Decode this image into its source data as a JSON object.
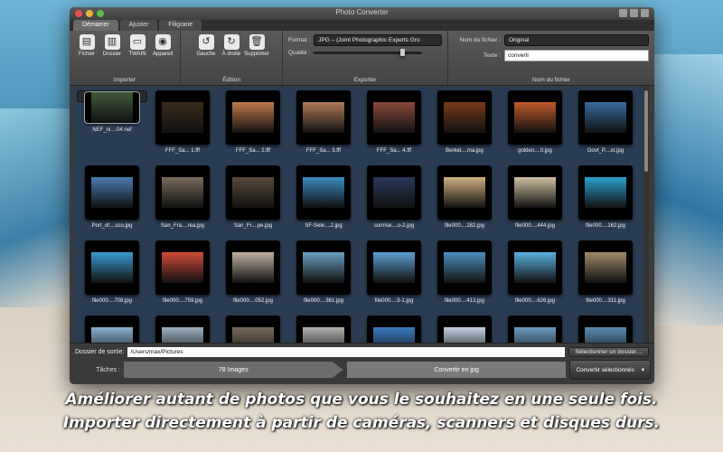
{
  "window": {
    "title": "Photo Converter"
  },
  "tabs": [
    {
      "label": "Démarrer"
    },
    {
      "label": "Ajuster"
    },
    {
      "label": "Filigrane"
    }
  ],
  "toolbar": {
    "import": {
      "group_label": "Importer",
      "buttons": [
        {
          "label": "Fichier",
          "icon": "file-icon"
        },
        {
          "label": "Dossier",
          "icon": "folder-icon"
        },
        {
          "label": "TWAIN",
          "icon": "scanner-icon"
        },
        {
          "label": "Appareil",
          "icon": "camera-icon"
        }
      ]
    },
    "edit": {
      "group_label": "Édition",
      "buttons": [
        {
          "label": "Gauche",
          "icon": "rotate-left-icon"
        },
        {
          "label": "À droite",
          "icon": "rotate-right-icon"
        },
        {
          "label": "Supprimer",
          "icon": "trash-icon"
        }
      ]
    },
    "export": {
      "group_label": "Exporter",
      "format_label": "Format :",
      "format_value": "JPG – (Joint Photographic Experts Gro",
      "quality_label": "Qualité :",
      "quality_fraction": 0.8
    },
    "filename": {
      "group_label": "Nom du fichier",
      "name_label": "Nom du fichier :",
      "name_value": "Original",
      "text_label": "Texte :",
      "text_value": "converti"
    }
  },
  "photos": [
    {
      "caption": "NEF_ni....04.nef",
      "color": "#3f5a3a",
      "selected": true
    },
    {
      "caption": "FFF_Sa... 1.fff",
      "color": "#3a2a1a"
    },
    {
      "caption": "FFF_Sa... 2.fff",
      "color": "#c07a4a"
    },
    {
      "caption": "FFF_Sa... 3.fff",
      "color": "#b07a5a"
    },
    {
      "caption": "FFF_Sa... 4.fff",
      "color": "#8a4a3a"
    },
    {
      "caption": "Berkel....ma.jpg",
      "color": "#7a3a1a"
    },
    {
      "caption": "golden....0.jpg",
      "color": "#c05a2a"
    },
    {
      "caption": "Govt_P....xt.jpg",
      "color": "#3a6aa0"
    },
    {
      "caption": "Port_of....sco.jpg",
      "color": "#4a7ab0"
    },
    {
      "caption": "San_Fra....rea.jpg",
      "color": "#7a6a5a"
    },
    {
      "caption": "San_Fr....pe.jpg",
      "color": "#5a4a3a"
    },
    {
      "caption": "SF-Sele....2.jpg",
      "color": "#3a8ac0"
    },
    {
      "caption": "sunrise....o-2.jpg",
      "color": "#2a3a5a"
    },
    {
      "caption": "file000....282.jpg",
      "color": "#d0b080"
    },
    {
      "caption": "file000....444.jpg",
      "color": "#d0c0a0"
    },
    {
      "caption": "file000....162.jpg",
      "color": "#2aa0d0"
    },
    {
      "caption": "file000....708.jpg",
      "color": "#3a9ad0"
    },
    {
      "caption": "file000....759.jpg",
      "color": "#d04a3a"
    },
    {
      "caption": "file000....052.jpg",
      "color": "#c0b0a0"
    },
    {
      "caption": "file000....361.jpg",
      "color": "#6aa0c0"
    },
    {
      "caption": "file000....3-1.jpg",
      "color": "#5aa0d0"
    },
    {
      "caption": "file000....413.jpg",
      "color": "#4a90c0"
    },
    {
      "caption": "file000....626.jpg",
      "color": "#5ab0e0"
    },
    {
      "caption": "file000....311.jpg",
      "color": "#a08a6a"
    },
    {
      "caption": "",
      "color": "#8ab0d0"
    },
    {
      "caption": "",
      "color": "#9ab0c0"
    },
    {
      "caption": "",
      "color": "#7a6a5a"
    },
    {
      "caption": "",
      "color": "#b0b0b0"
    },
    {
      "caption": "",
      "color": "#3a7ac0"
    },
    {
      "caption": "",
      "color": "#c0d0e0"
    },
    {
      "caption": "",
      "color": "#6a9ac0"
    },
    {
      "caption": "",
      "color": "#5a8ab0"
    }
  ],
  "bottom": {
    "output_label": "Dossier de sortie:",
    "output_path": "/Users/max/Pictures",
    "choose_folder": "Sélectionner un dossier....",
    "tasks_label": "Tâches :",
    "stage_images": "78 Images",
    "stage_convert": "Convertir en jpg",
    "convert_button": "Convertir sélectionnés"
  },
  "caption": {
    "line1": "Améliorer autant de photos que vous le souhaitez en une seule fois.",
    "line2": "Importer directement à partir de caméras, scanners et disques durs."
  }
}
